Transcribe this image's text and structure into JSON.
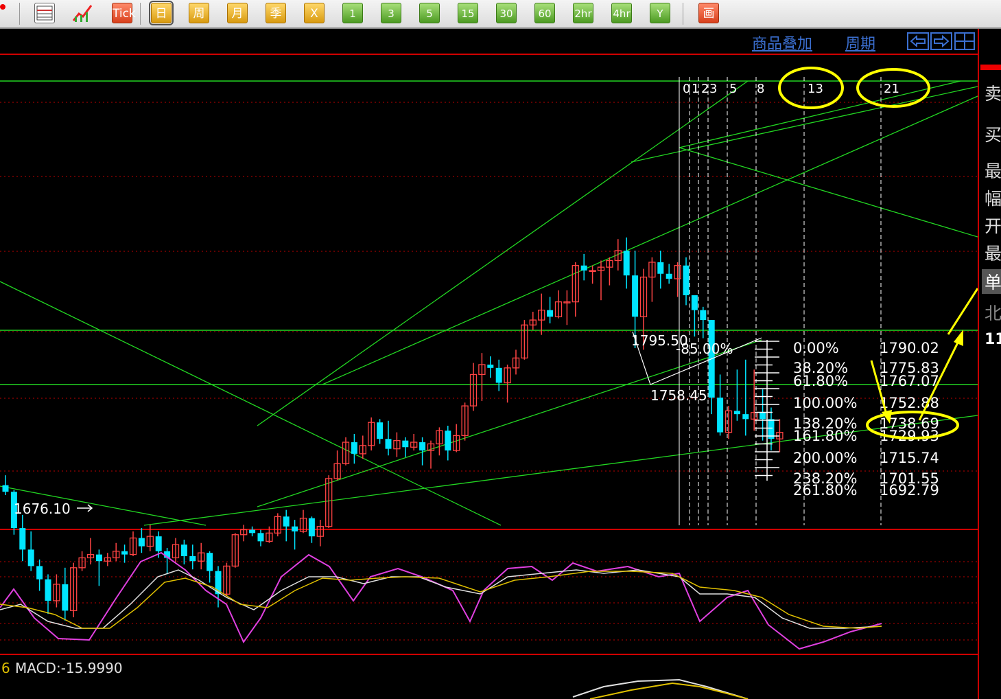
{
  "toolbar": {
    "buttons": [
      {
        "label": "Tick",
        "kind": "red"
      },
      {
        "label": "日",
        "kind": "gold"
      },
      {
        "label": "周",
        "kind": "gold"
      },
      {
        "label": "月",
        "kind": "gold"
      },
      {
        "label": "季",
        "kind": "gold"
      },
      {
        "label": "X",
        "kind": "gold"
      },
      {
        "label": "1",
        "kind": "green"
      },
      {
        "label": "3",
        "kind": "green"
      },
      {
        "label": "5",
        "kind": "green"
      },
      {
        "label": "15",
        "kind": "green"
      },
      {
        "label": "30",
        "kind": "green"
      },
      {
        "label": "60",
        "kind": "green"
      },
      {
        "label": "2hr",
        "kind": "green"
      },
      {
        "label": "4hr",
        "kind": "green"
      },
      {
        "label": "Y",
        "kind": "green"
      },
      {
        "label": "画",
        "kind": "red"
      }
    ],
    "icons": [
      "table-icon",
      "line-chart-icon"
    ]
  },
  "top_links": {
    "overlay": "商品叠加",
    "period": "周期"
  },
  "right_panel": {
    "items": [
      "卖",
      "买",
      "最",
      "幅",
      "开",
      "最",
      "单",
      "北",
      "11"
    ]
  },
  "colors": {
    "up": "#ff4444",
    "down": "#00e5ff",
    "grid": "#c00000",
    "trendline": "#22d622",
    "highlight": "#ffff00"
  },
  "chart_data": {
    "type": "candlestick",
    "low_label": "1676.10",
    "swing_low": "1758.45",
    "swing_high": "1795.50",
    "fibonacci_time_labels": [
      "0",
      "1",
      "2",
      "3",
      "5",
      "8",
      "13",
      "21"
    ],
    "fib_angle_label": "-85.00%",
    "fibonacci_levels": [
      {
        "pct": "0.00%",
        "price": "1790.02"
      },
      {
        "pct": "38.20%",
        "price": "1775.83"
      },
      {
        "pct": "61.80%",
        "price": "1767.07"
      },
      {
        "pct": "100.00%",
        "price": "1752.88"
      },
      {
        "pct": "138.20%",
        "price": "1738.69"
      },
      {
        "pct": "161.80%",
        "price": "1729.93"
      },
      {
        "pct": "200.00%",
        "price": "1715.74"
      },
      {
        "pct": "238.20%",
        "price": "1701.55"
      },
      {
        "pct": "261.80%",
        "price": "1692.79"
      }
    ],
    "candles": [
      [
        1690,
        1686,
        1696,
        1684
      ],
      [
        1686,
        1664,
        1687,
        1660
      ],
      [
        1664,
        1651,
        1672,
        1644
      ],
      [
        1651,
        1641,
        1662,
        1638
      ],
      [
        1641,
        1633,
        1645,
        1626
      ],
      [
        1633,
        1620,
        1636,
        1612
      ],
      [
        1620,
        1630,
        1636,
        1616
      ],
      [
        1630,
        1614,
        1640,
        1608
      ],
      [
        1614,
        1640,
        1643,
        1610
      ],
      [
        1640,
        1646,
        1650,
        1638
      ],
      [
        1646,
        1648,
        1658,
        1642
      ],
      [
        1648,
        1644,
        1651,
        1629
      ],
      [
        1644,
        1646,
        1649,
        1641
      ],
      [
        1646,
        1650,
        1655,
        1644
      ],
      [
        1650,
        1648,
        1654,
        1643
      ],
      [
        1648,
        1658,
        1662,
        1647
      ],
      [
        1658,
        1653,
        1664,
        1649
      ],
      [
        1653,
        1659,
        1666,
        1650
      ],
      [
        1659,
        1650,
        1662,
        1646
      ],
      [
        1650,
        1646,
        1652,
        1636
      ],
      [
        1646,
        1654,
        1658,
        1643
      ],
      [
        1654,
        1647,
        1657,
        1642
      ],
      [
        1647,
        1644,
        1654,
        1639
      ],
      [
        1644,
        1649,
        1655,
        1639
      ],
      [
        1649,
        1638,
        1650,
        1631
      ],
      [
        1638,
        1624,
        1641,
        1616
      ],
      [
        1624,
        1641,
        1643,
        1623
      ],
      [
        1641,
        1660,
        1661,
        1640
      ],
      [
        1660,
        1663,
        1666,
        1656
      ],
      [
        1663,
        1661,
        1665,
        1659
      ],
      [
        1661,
        1656,
        1663,
        1653
      ],
      [
        1656,
        1661,
        1665,
        1655
      ],
      [
        1661,
        1671,
        1673,
        1659
      ],
      [
        1671,
        1665,
        1675,
        1656
      ],
      [
        1665,
        1662,
        1669,
        1651
      ],
      [
        1662,
        1670,
        1675,
        1661
      ],
      [
        1670,
        1659,
        1671,
        1655
      ],
      [
        1659,
        1665,
        1669,
        1653
      ],
      [
        1665,
        1694,
        1696,
        1664
      ],
      [
        1694,
        1703,
        1711,
        1693
      ],
      [
        1703,
        1716,
        1719,
        1702
      ],
      [
        1716,
        1709,
        1721,
        1703
      ],
      [
        1709,
        1714,
        1720,
        1706
      ],
      [
        1714,
        1728,
        1731,
        1711
      ],
      [
        1728,
        1718,
        1730,
        1715
      ],
      [
        1718,
        1712,
        1729,
        1708
      ],
      [
        1712,
        1717,
        1722,
        1707
      ],
      [
        1717,
        1713,
        1719,
        1707
      ],
      [
        1713,
        1716,
        1721,
        1711
      ],
      [
        1716,
        1711,
        1719,
        1702
      ],
      [
        1711,
        1715,
        1717,
        1700
      ],
      [
        1715,
        1723,
        1725,
        1708
      ],
      [
        1723,
        1711,
        1726,
        1705
      ],
      [
        1711,
        1720,
        1727,
        1710
      ],
      [
        1720,
        1738,
        1740,
        1717
      ],
      [
        1738,
        1757,
        1764,
        1735
      ],
      [
        1757,
        1763,
        1770,
        1741
      ],
      [
        1763,
        1761,
        1768,
        1755
      ],
      [
        1761,
        1752,
        1766,
        1747
      ],
      [
        1752,
        1761,
        1763,
        1740
      ],
      [
        1761,
        1767,
        1772,
        1757
      ],
      [
        1767,
        1787,
        1790,
        1766
      ],
      [
        1787,
        1790,
        1795,
        1784
      ],
      [
        1790,
        1796,
        1806,
        1781
      ],
      [
        1796,
        1792,
        1804,
        1788
      ],
      [
        1792,
        1801,
        1808,
        1791
      ],
      [
        1801,
        1801,
        1808,
        1787
      ],
      [
        1801,
        1823,
        1825,
        1792
      ],
      [
        1823,
        1820,
        1830,
        1814
      ],
      [
        1820,
        1820,
        1823,
        1812
      ],
      [
        1820,
        1822,
        1826,
        1802
      ],
      [
        1822,
        1826,
        1828,
        1811
      ],
      [
        1826,
        1832,
        1839,
        1820
      ],
      [
        1832,
        1817,
        1840,
        1809
      ],
      [
        1817,
        1792,
        1832,
        1773
      ],
      [
        1792,
        1816,
        1821,
        1772
      ],
      [
        1816,
        1825,
        1828,
        1801
      ],
      [
        1825,
        1818,
        1832,
        1809
      ],
      [
        1818,
        1815,
        1824,
        1812
      ],
      [
        1815,
        1823,
        1825,
        1804
      ],
      [
        1823,
        1805,
        1828,
        1799
      ],
      [
        1805,
        1796,
        1805,
        1780
      ],
      [
        1796,
        1790,
        1798,
        1779
      ],
      [
        1790,
        1743,
        1790,
        1733
      ],
      [
        1743,
        1722,
        1757,
        1720
      ],
      [
        1722,
        1735,
        1738,
        1718
      ],
      [
        1735,
        1733,
        1760,
        1729
      ],
      [
        1733,
        1730,
        1766,
        1720
      ],
      [
        1730,
        1734,
        1760,
        1723
      ],
      [
        1734,
        1730,
        1748,
        1717
      ],
      [
        1730,
        1718,
        1737,
        1711
      ],
      [
        1718,
        1722,
        1730,
        1710
      ]
    ]
  },
  "indicators": {
    "macd_label": "MACD:-15.9990",
    "macd_prefix": "6"
  }
}
